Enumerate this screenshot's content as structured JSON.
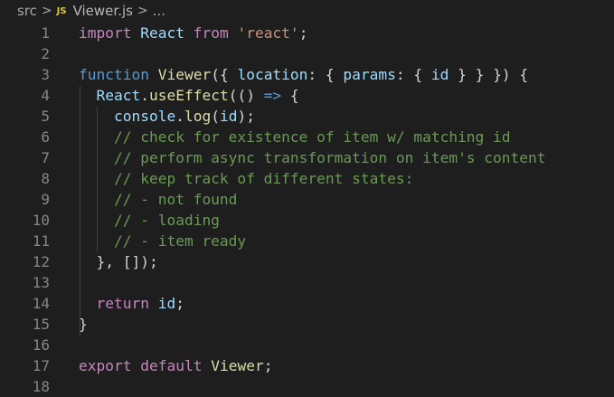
{
  "breadcrumb": {
    "folder": "src",
    "file_icon": "JS",
    "file": "Viewer.js",
    "more": "...",
    "separator": ">"
  },
  "editor": {
    "line_numbers": [
      "1",
      "2",
      "3",
      "4",
      "5",
      "6",
      "7",
      "8",
      "9",
      "10",
      "11",
      "12",
      "13",
      "14",
      "15",
      "16",
      "17",
      "18"
    ],
    "lines": [
      [
        {
          "t": "import",
          "c": "kw2"
        },
        {
          "t": " React ",
          "c": "vr"
        },
        {
          "t": "from",
          "c": "kw2"
        },
        {
          "t": " ",
          "c": "pn"
        },
        {
          "t": "'react'",
          "c": "str"
        },
        {
          "t": ";",
          "c": "pn"
        }
      ],
      [],
      [
        {
          "t": "function",
          "c": "kw"
        },
        {
          "t": " ",
          "c": "pn"
        },
        {
          "t": "Viewer",
          "c": "fn"
        },
        {
          "t": "({ ",
          "c": "pn"
        },
        {
          "t": "location",
          "c": "vr"
        },
        {
          "t": ": { ",
          "c": "pn"
        },
        {
          "t": "params",
          "c": "vr"
        },
        {
          "t": ": { ",
          "c": "pn"
        },
        {
          "t": "id",
          "c": "vr"
        },
        {
          "t": " } } }) {",
          "c": "pn"
        }
      ],
      [
        {
          "t": "  ",
          "c": "pn"
        },
        {
          "t": "React",
          "c": "vr"
        },
        {
          "t": ".",
          "c": "pn"
        },
        {
          "t": "useEffect",
          "c": "fn"
        },
        {
          "t": "(() ",
          "c": "pn"
        },
        {
          "t": "=>",
          "c": "kw"
        },
        {
          "t": " {",
          "c": "pn"
        }
      ],
      [
        {
          "t": "    ",
          "c": "pn"
        },
        {
          "t": "console",
          "c": "vr"
        },
        {
          "t": ".",
          "c": "pn"
        },
        {
          "t": "log",
          "c": "fn"
        },
        {
          "t": "(",
          "c": "pn"
        },
        {
          "t": "id",
          "c": "vr"
        },
        {
          "t": ");",
          "c": "pn"
        }
      ],
      [
        {
          "t": "    // check for existence of item w/ matching id",
          "c": "cm"
        }
      ],
      [
        {
          "t": "    // perform async transformation on item's content",
          "c": "cm"
        }
      ],
      [
        {
          "t": "    // keep track of different states:",
          "c": "cm"
        }
      ],
      [
        {
          "t": "    // - not found",
          "c": "cm"
        }
      ],
      [
        {
          "t": "    // - loading",
          "c": "cm"
        }
      ],
      [
        {
          "t": "    // - item ready",
          "c": "cm"
        }
      ],
      [
        {
          "t": "  }, []);",
          "c": "pn"
        }
      ],
      [],
      [
        {
          "t": "  ",
          "c": "pn"
        },
        {
          "t": "return",
          "c": "kw2"
        },
        {
          "t": " ",
          "c": "pn"
        },
        {
          "t": "id",
          "c": "vr"
        },
        {
          "t": ";",
          "c": "pn"
        }
      ],
      [
        {
          "t": "}",
          "c": "pn"
        }
      ],
      [],
      [
        {
          "t": "export",
          "c": "kw2"
        },
        {
          "t": " ",
          "c": "pn"
        },
        {
          "t": "default",
          "c": "kw2"
        },
        {
          "t": " ",
          "c": "pn"
        },
        {
          "t": "Viewer",
          "c": "fn"
        },
        {
          "t": ";",
          "c": "pn"
        }
      ],
      []
    ]
  },
  "colors": {
    "background": "#1e1e1e",
    "keyword": "#569cd6",
    "control_keyword": "#c586c0",
    "function": "#dcdcaa",
    "variable": "#9cdcfe",
    "string": "#ce9178",
    "comment": "#6a9955",
    "line_number": "#858585"
  }
}
